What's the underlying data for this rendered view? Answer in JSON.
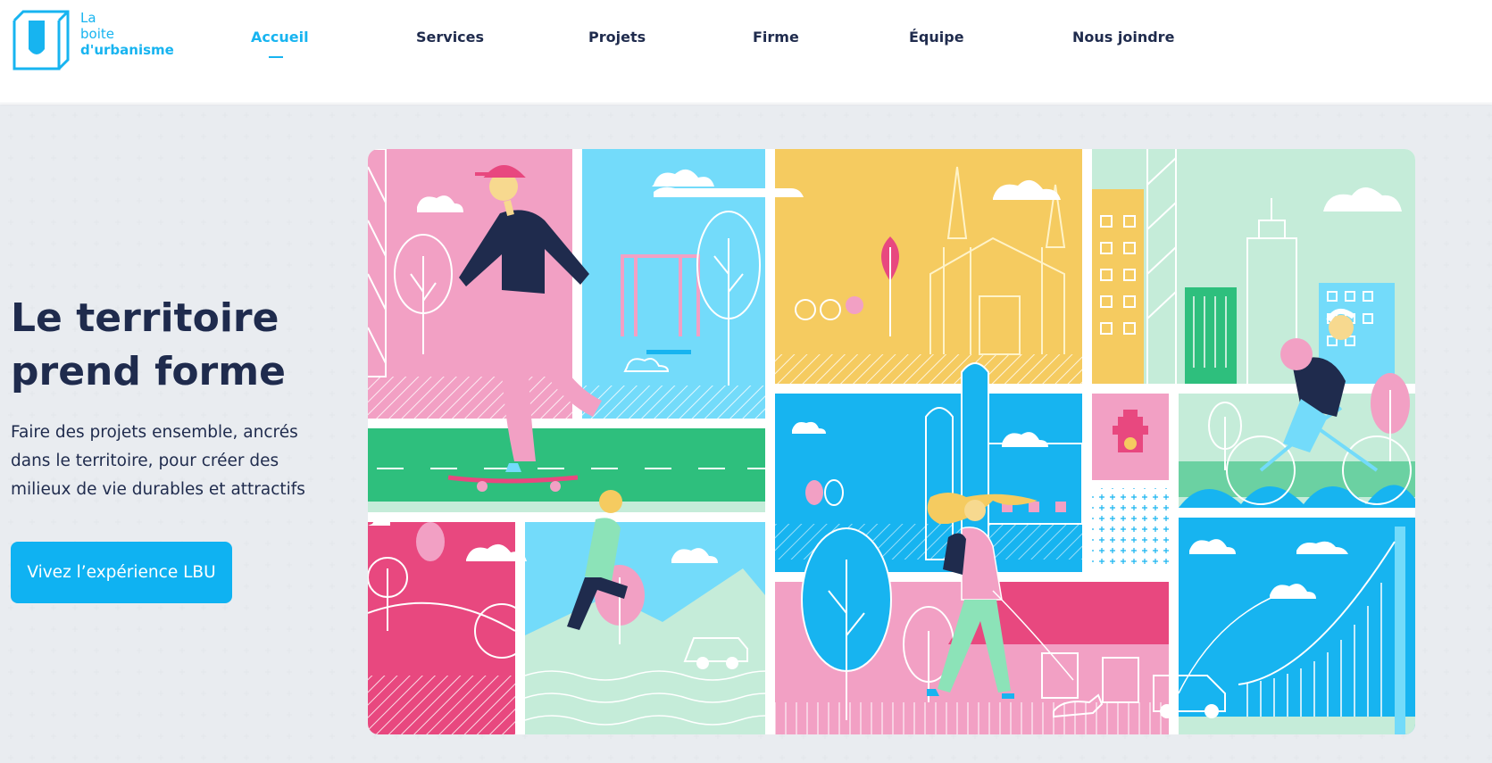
{
  "brand": {
    "logo_line1": "La",
    "logo_line2": "boite",
    "logo_line3": "d'urbanisme",
    "color": "#17b4f0"
  },
  "nav": {
    "items": [
      {
        "label": "Accueil",
        "active": true
      },
      {
        "label": "Services",
        "active": false
      },
      {
        "label": "Projets",
        "active": false
      },
      {
        "label": "Firme",
        "active": false
      },
      {
        "label": "Équipe",
        "active": false
      },
      {
        "label": "Nous joindre",
        "active": false
      }
    ]
  },
  "hero": {
    "title_line1": "Le territoire",
    "title_line2": "prend forme",
    "text_line1": "Faire des projets ensemble, ancrés",
    "text_line2": "dans le territoire, pour créer des",
    "text_line3": "milieux de vie durables et attractifs",
    "cta_label": "Vivez l’expérience LBU"
  },
  "colors": {
    "navy": "#1f2b4d",
    "accent": "#0fb2f2",
    "pink": "#f2a0c4",
    "hot_pink": "#e8487f",
    "sky": "#73dbfa",
    "yellow": "#f5cb60",
    "mint": "#c5ecd9",
    "green": "#2ebf7d"
  },
  "icons": {
    "logo": "lbu-logo-icon",
    "illustration": "city-life-illustration"
  }
}
